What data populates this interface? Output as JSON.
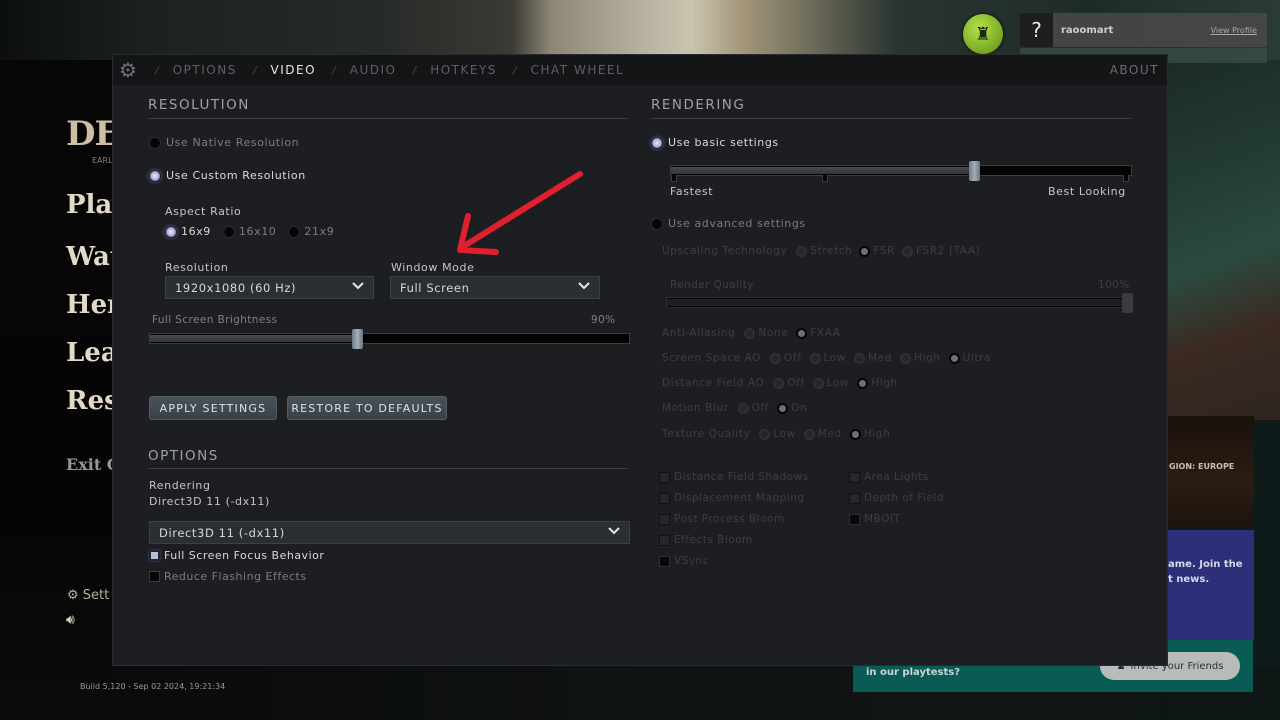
{
  "background": {
    "game_logo": "DE",
    "game_subtitle": "EARL",
    "menu": [
      "Play",
      "Wat",
      "Her",
      "Lear",
      "Res"
    ],
    "exit": "Exit G",
    "settings_link": "Sett",
    "build_info": "Build 5,120 - Sep 02 2024, 19:21:34",
    "profile": {
      "avatar_placeholder": "?",
      "username": "raoomart",
      "view_profile": "View Profile"
    },
    "promos": {
      "region": "GION: EUROPE",
      "blue_line1": "ame. Join the",
      "blue_line2": "t news.",
      "teal_text": "in our playtests?",
      "invite_button": "Invite your Friends"
    }
  },
  "settings": {
    "tabs": [
      {
        "label": "OPTIONS",
        "active": false
      },
      {
        "label": "VIDEO",
        "active": true
      },
      {
        "label": "AUDIO",
        "active": false
      },
      {
        "label": "HOTKEYS",
        "active": false
      },
      {
        "label": "CHAT WHEEL",
        "active": false
      }
    ],
    "about": "ABOUT",
    "resolution": {
      "title": "RESOLUTION",
      "native_label": "Use Native Resolution",
      "custom_label": "Use Custom Resolution",
      "selected_mode": "custom",
      "aspect_ratio_label": "Aspect Ratio",
      "aspect_options": [
        "16x9",
        "16x10",
        "21x9"
      ],
      "aspect_selected": "16x9",
      "resolution_label": "Resolution",
      "resolution_value": "1920x1080 (60 Hz)",
      "window_mode_label": "Window Mode",
      "window_mode_value": "Full Screen",
      "brightness_label": "Full Screen Brightness",
      "brightness_value": "90%",
      "brightness_fraction": 0.9,
      "apply_button": "APPLY SETTINGS",
      "restore_button": "RESTORE TO DEFAULTS"
    },
    "options": {
      "title": "OPTIONS",
      "rendering_label": "Rendering",
      "rendering_current": "Direct3D 11 (-dx11)",
      "rendering_dropdown_value": "Direct3D 11 (-dx11)",
      "full_screen_focus_label": "Full Screen Focus Behavior",
      "full_screen_focus_checked": true,
      "reduce_flashing_label": "Reduce Flashing Effects",
      "reduce_flashing_checked": false
    },
    "rendering": {
      "title": "RENDERING",
      "basic_label": "Use basic settings",
      "advanced_label": "Use advanced settings",
      "selected_mode": "basic",
      "quality_slider_min_label": "Fastest",
      "quality_slider_max_label": "Best Looking",
      "quality_fraction": 0.66,
      "upscaling_label": "Upscaling Technology",
      "upscaling_options": [
        "Stretch",
        "FSR",
        "FSR2 (TAA)"
      ],
      "upscaling_selected": "FSR",
      "render_quality_label": "Render Quality",
      "render_quality_value": "100%",
      "render_quality_fraction": 1.0,
      "radio_groups": [
        {
          "label": "Anti-Aliasing",
          "options": [
            "None",
            "FXAA"
          ],
          "selected": "FXAA"
        },
        {
          "label": "Screen Space AO",
          "options": [
            "Off",
            "Low",
            "Med",
            "High",
            "Ultra"
          ],
          "selected": "Ultra"
        },
        {
          "label": "Distance Field AO",
          "options": [
            "Off",
            "Low",
            "High"
          ],
          "selected": "High"
        },
        {
          "label": "Motion Blur",
          "options": [
            "Off",
            "On"
          ],
          "selected": "On"
        },
        {
          "label": "Texture Quality",
          "options": [
            "Low",
            "Med",
            "High"
          ],
          "selected": "High"
        }
      ],
      "checkboxes_left": [
        {
          "label": "Distance Field Shadows",
          "checked": true
        },
        {
          "label": "Displacement Mapping",
          "checked": true
        },
        {
          "label": "Post Process Bloom",
          "checked": true
        },
        {
          "label": "Effects Bloom",
          "checked": true
        },
        {
          "label": "VSync",
          "checked": false
        }
      ],
      "checkboxes_right": [
        {
          "label": "Area Lights",
          "checked": true
        },
        {
          "label": "Depth of Field",
          "checked": true
        },
        {
          "label": "MBOIT",
          "checked": false
        }
      ]
    }
  },
  "annotation": {
    "arrow_color": "#e0202f",
    "points_to": "Window Mode"
  }
}
